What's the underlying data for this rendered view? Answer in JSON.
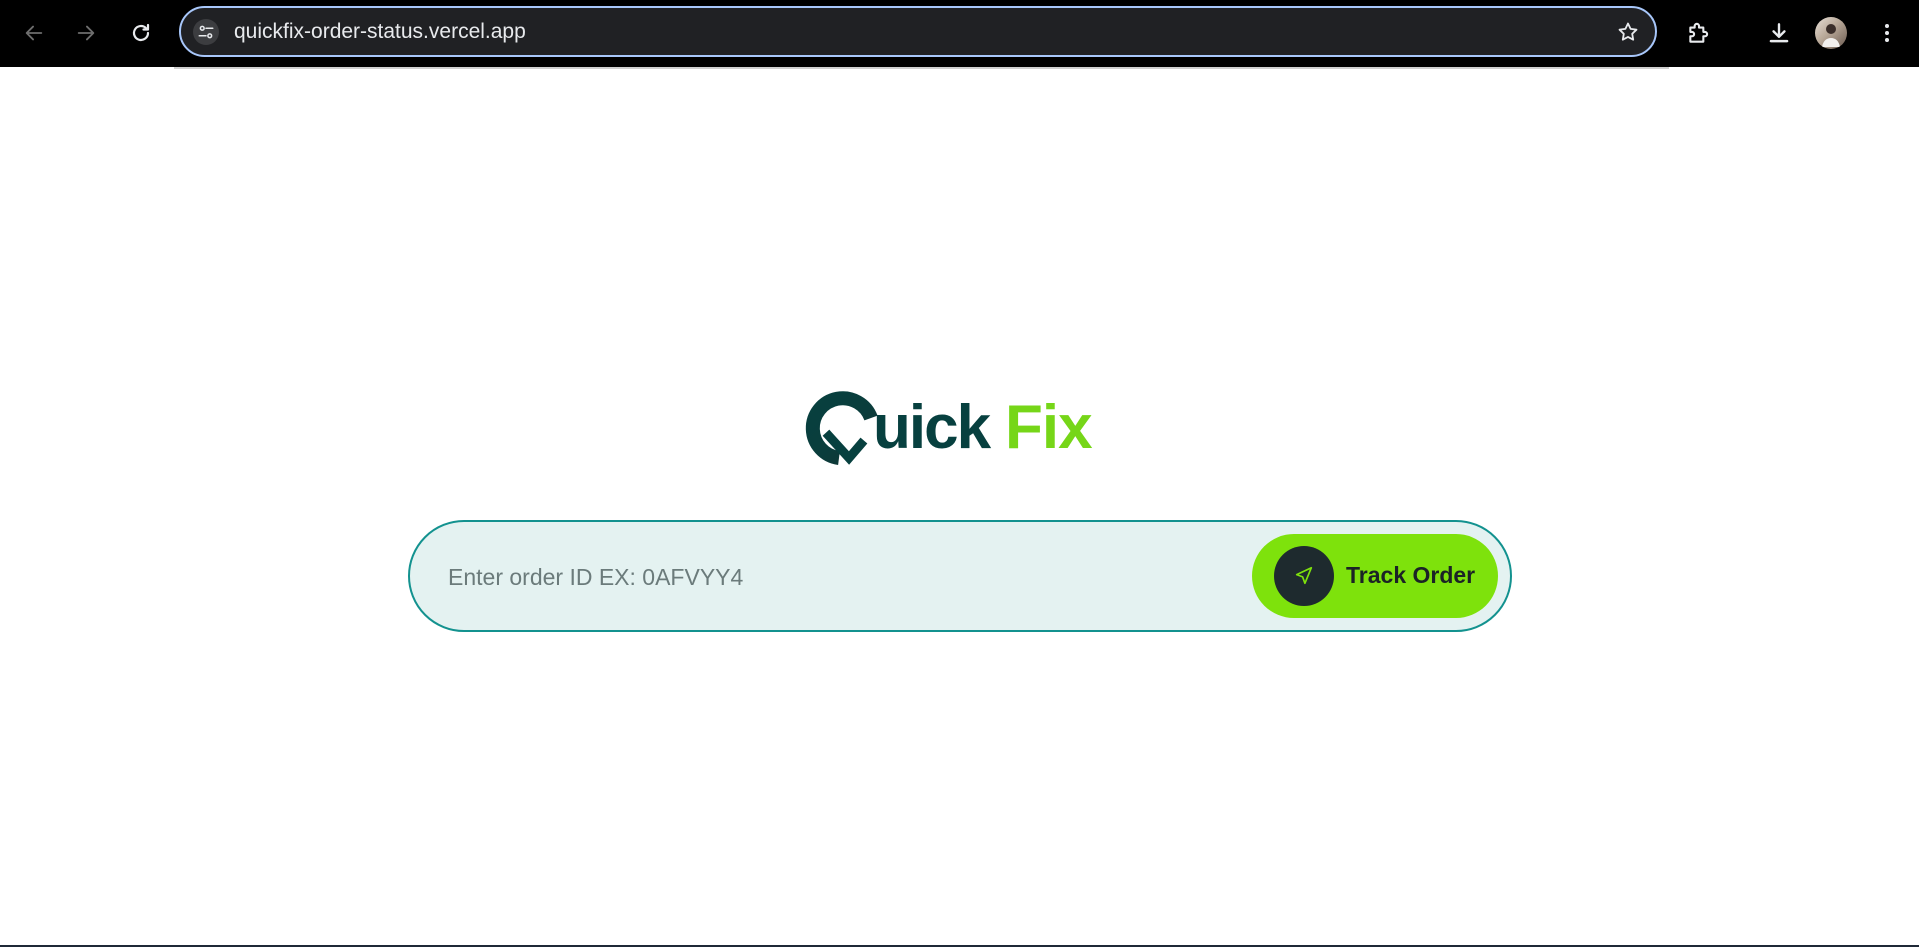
{
  "browser": {
    "url": "quickfix-order-status.vercel.app",
    "icons": {
      "back": "arrow-left-icon",
      "forward": "arrow-right-icon",
      "reload": "reload-icon",
      "site_info": "tune-icon",
      "bookmark": "star-icon",
      "extensions": "puzzle-icon",
      "downloads": "download-icon",
      "profile": "avatar",
      "menu": "kebab-menu-icon"
    }
  },
  "logo": {
    "part1": "Quick",
    "part2": "Fix",
    "colors": {
      "dark": "#07403f",
      "accent": "#76d618"
    }
  },
  "search": {
    "placeholder": "Enter order ID EX: 0AFVYY4",
    "value": "",
    "button_label": "Track Order",
    "button_icon": "send-icon",
    "colors": {
      "border": "#13928f",
      "fill": "#e4f2f1",
      "button": "#7ee20c"
    }
  }
}
